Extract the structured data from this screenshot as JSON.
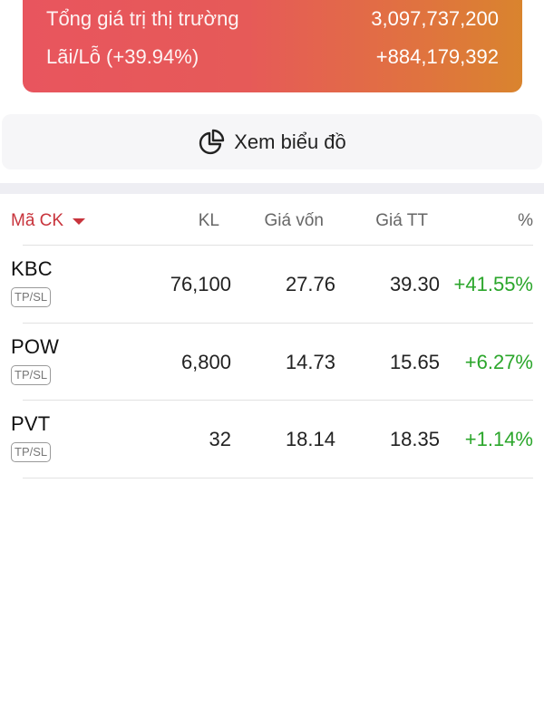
{
  "summary": {
    "market_value_label": "Tổng giá trị thị trường",
    "market_value": "3,097,737,200",
    "pnl_label": "Lãi/Lỗ (+39.94%)",
    "pnl_value": "+884,179,392",
    "gradient_colors": [
      "#e8555e",
      "#d9842e"
    ]
  },
  "chart_button": {
    "icon": "pie-chart-icon",
    "label": "Xem biểu đồ"
  },
  "table": {
    "headers": {
      "symbol": "Mã CK",
      "volume": "KL",
      "cost_price": "Giá vốn",
      "market_price": "Giá TT",
      "percent": "%"
    },
    "sort_icon": "caret-down-icon",
    "rows": [
      {
        "symbol": "KBC",
        "tag": "TP/SL",
        "volume": "76,100",
        "cost_price": "27.76",
        "market_price": "39.30",
        "percent": "+41.55%"
      },
      {
        "symbol": "POW",
        "tag": "TP/SL",
        "volume": "6,800",
        "cost_price": "14.73",
        "market_price": "15.65",
        "percent": "+6.27%"
      },
      {
        "symbol": "PVT",
        "tag": "TP/SL",
        "volume": "32",
        "cost_price": "18.14",
        "market_price": "18.35",
        "percent": "+1.14%"
      }
    ]
  },
  "colors": {
    "accent_red": "#c8343c",
    "gain_green": "#2ba62b"
  }
}
